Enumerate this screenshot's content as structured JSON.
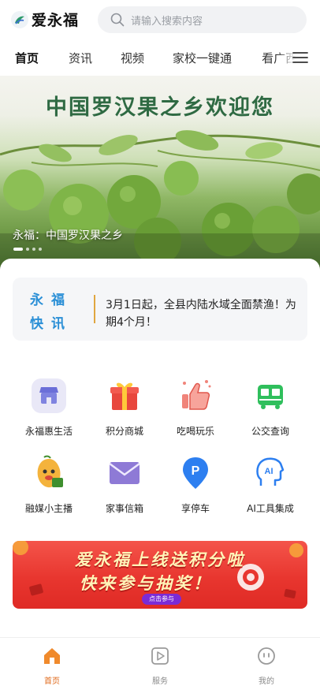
{
  "header": {
    "app_title": "爱永福",
    "logo_icon": "app-logo-icon",
    "search": {
      "placeholder": "请输入搜索内容",
      "icon": "search-icon"
    }
  },
  "nav": {
    "tabs": [
      {
        "label": "首页",
        "active": true
      },
      {
        "label": "资讯",
        "active": false
      },
      {
        "label": "视频",
        "active": false
      },
      {
        "label": "家校一键通",
        "active": false
      },
      {
        "label": "看广西",
        "active": false
      }
    ],
    "menu_icon": "menu-icon"
  },
  "banner": {
    "headline": "中国罗汉果之乡欢迎您",
    "caption": "永福：中国罗汉果之乡",
    "slide_count": 4,
    "active_slide": 0
  },
  "news": {
    "badge_line1": "永福",
    "badge_line2": "快讯",
    "text": "3月1日起，全县内陆水域全面禁渔！为期4个月！"
  },
  "services": [
    {
      "label": "永福惠生活",
      "icon": "store-icon"
    },
    {
      "label": "积分商城",
      "icon": "gift-icon"
    },
    {
      "label": "吃喝玩乐",
      "icon": "thumbs-up-icon"
    },
    {
      "label": "公交查询",
      "icon": "bus-icon"
    },
    {
      "label": "融媒小主播",
      "icon": "mascot-icon"
    },
    {
      "label": "家事信箱",
      "icon": "mail-icon"
    },
    {
      "label": "享停车",
      "icon": "parking-icon"
    },
    {
      "label": "AI工具集成",
      "icon": "ai-head-icon"
    }
  ],
  "promo": {
    "line1": "爱永福上线送积分啦",
    "line2": "快来参与抽奖！",
    "button": "点击参与"
  },
  "tabbar": {
    "items": [
      {
        "label": "首页",
        "icon": "home-icon",
        "active": true
      },
      {
        "label": "服务",
        "icon": "play-icon",
        "active": false
      },
      {
        "label": "我的",
        "icon": "profile-icon",
        "active": false
      }
    ]
  },
  "colors": {
    "accent": "#e06a1b",
    "news_badge": "#2a8fd6",
    "promo_red": "#e8362f",
    "banner_title": "#2f6a43"
  }
}
